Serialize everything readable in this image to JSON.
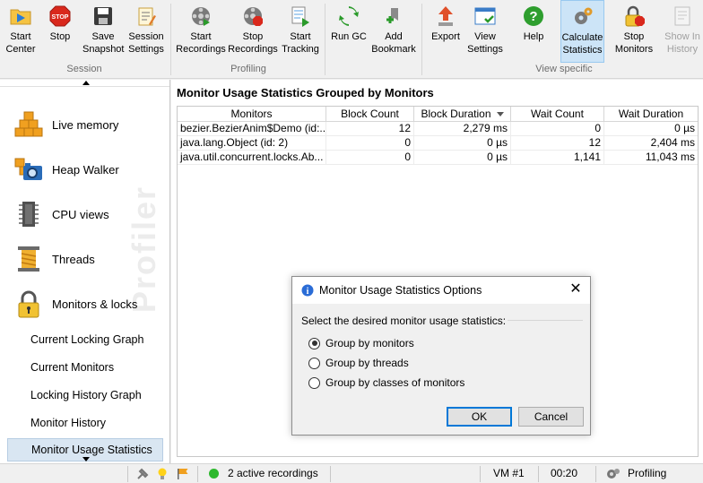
{
  "toolbar": {
    "groups": [
      {
        "label": "Session"
      },
      {
        "label": "Profiling"
      },
      {
        "label": "View specific"
      }
    ],
    "buttons": [
      {
        "label": "Start Center",
        "icon": "start-center-icon"
      },
      {
        "label": "Stop",
        "icon": "stop-icon"
      },
      {
        "label": "Save Snapshot",
        "icon": "save-snapshot-icon"
      },
      {
        "label": "Session Settings",
        "icon": "session-settings-icon"
      },
      {
        "label": "Start Recordings",
        "icon": "start-recordings-icon"
      },
      {
        "label": "Stop Recordings",
        "icon": "stop-recordings-icon"
      },
      {
        "label": "Start Tracking",
        "icon": "start-tracking-icon"
      },
      {
        "label": "Run GC",
        "icon": "run-gc-icon"
      },
      {
        "label": "Add Bookmark",
        "icon": "add-bookmark-icon"
      },
      {
        "label": "Export",
        "icon": "export-icon"
      },
      {
        "label": "View Settings",
        "icon": "view-settings-icon"
      },
      {
        "label": "Help",
        "icon": "help-icon"
      },
      {
        "label": "Calculate Statistics",
        "icon": "calculate-statistics-icon",
        "active": true
      },
      {
        "label": "Stop Monitors",
        "icon": "stop-monitors-icon"
      },
      {
        "label": "Show In History",
        "icon": "show-in-history-icon",
        "disabled": true
      }
    ]
  },
  "sidebar": {
    "sections": [
      {
        "label": "Live memory",
        "icon": "live-memory-icon"
      },
      {
        "label": "Heap Walker",
        "icon": "heap-walker-icon"
      },
      {
        "label": "CPU views",
        "icon": "cpu-views-icon"
      },
      {
        "label": "Threads",
        "icon": "threads-icon"
      },
      {
        "label": "Monitors & locks",
        "icon": "lock-icon"
      }
    ],
    "sub_items": [
      {
        "label": "Current Locking Graph"
      },
      {
        "label": "Current Monitors"
      },
      {
        "label": "Locking History Graph"
      },
      {
        "label": "Monitor History"
      },
      {
        "label": "Monitor Usage Statistics",
        "selected": true
      }
    ],
    "watermark": "Profiler"
  },
  "main": {
    "title": "Monitor Usage Statistics Grouped by Monitors",
    "columns": [
      "Monitors",
      "Block Count",
      "Block Duration",
      "Wait Count",
      "Wait Duration"
    ],
    "sorted_column": "Block Duration",
    "rows": [
      [
        "bezier.BezierAnim$Demo (id:...",
        "12",
        "2,279 ms",
        "0",
        "0 µs"
      ],
      [
        "java.lang.Object (id: 2)",
        "0",
        "0 µs",
        "12",
        "2,404 ms"
      ],
      [
        "java.util.concurrent.locks.Ab...",
        "0",
        "0 µs",
        "1,141",
        "11,043 ms"
      ]
    ]
  },
  "dialog": {
    "title": "Monitor Usage Statistics Options",
    "prompt": "Select the desired monitor usage statistics:",
    "options": [
      {
        "label": "Group by monitors",
        "checked": true
      },
      {
        "label": "Group by threads",
        "checked": false
      },
      {
        "label": "Group by classes of monitors",
        "checked": false
      }
    ],
    "ok_label": "OK",
    "cancel_label": "Cancel"
  },
  "statusbar": {
    "recordings": "2 active recordings",
    "vm": "VM #1",
    "time": "00:20",
    "mode": "Profiling",
    "recording_dot_color": "#2eb82e"
  }
}
